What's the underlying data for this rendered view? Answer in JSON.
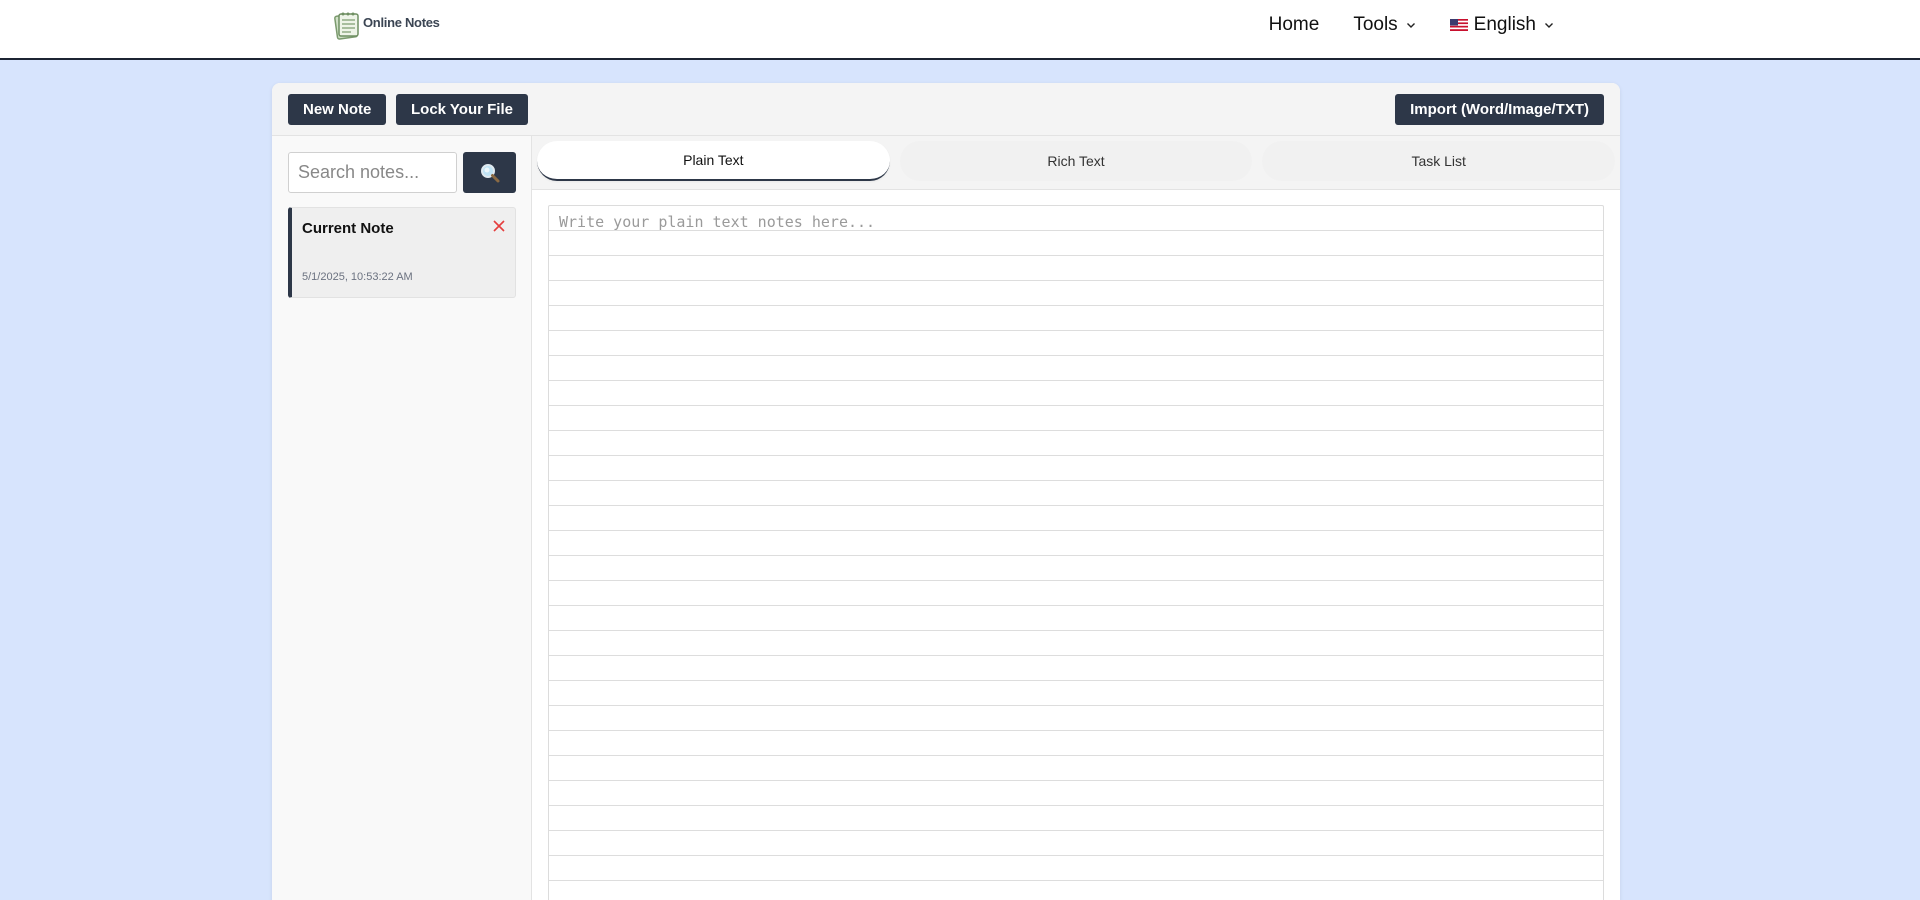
{
  "header": {
    "logo_text": "Online Notes",
    "nav": {
      "home": "Home",
      "tools": "Tools",
      "language": "English"
    }
  },
  "toolbar": {
    "new_note": "New Note",
    "lock_file": "Lock Your File",
    "import": "Import (Word/Image/TXT)"
  },
  "sidebar": {
    "search_placeholder": "Search notes...",
    "notes": [
      {
        "title": "Current Note",
        "date": "5/1/2025, 10:53:22 AM"
      }
    ]
  },
  "editor": {
    "tabs": [
      {
        "label": "Plain Text",
        "active": true
      },
      {
        "label": "Rich Text",
        "active": false
      },
      {
        "label": "Task List",
        "active": false
      }
    ],
    "placeholder": "Write your plain text notes here..."
  },
  "colors": {
    "page_bg": "#d7e4fd",
    "dark_button": "#2d3748",
    "close_x": "#e53e3e"
  },
  "icons": {
    "logo": "notepad-logo-icon",
    "search": "magnifier-icon",
    "close": "close-icon",
    "chevron": "chevron-down-icon",
    "flag": "us-flag-icon"
  }
}
